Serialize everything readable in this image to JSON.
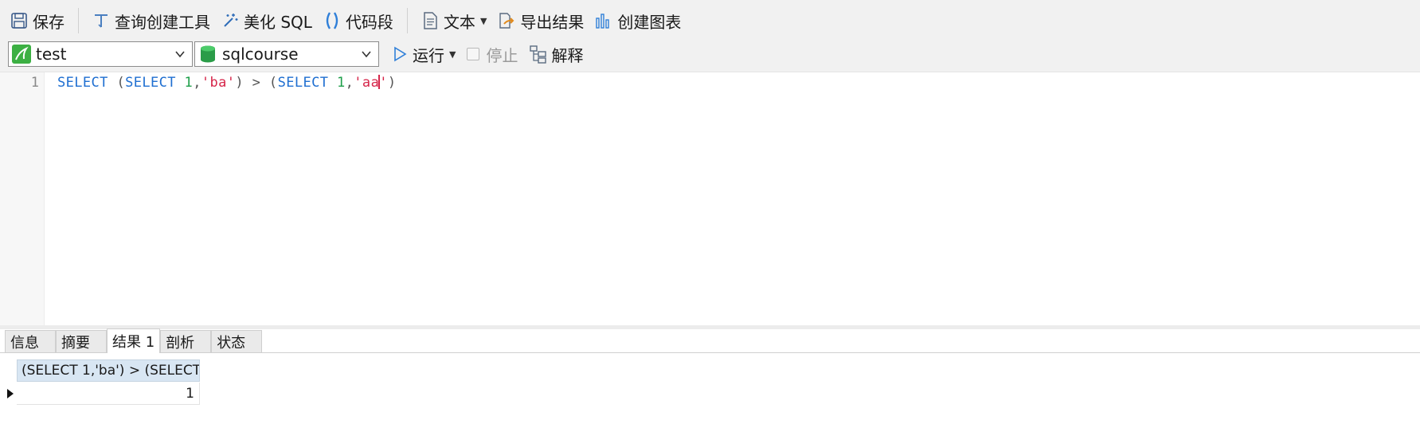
{
  "toolbar": {
    "save_label": "保存",
    "query_builder_label": "查询创建工具",
    "beautify_label": "美化 SQL",
    "snippet_label": "代码段",
    "text_label": "文本",
    "export_label": "导出结果",
    "chart_label": "创建图表"
  },
  "connection": {
    "value": "test"
  },
  "database": {
    "value": "sqlcourse"
  },
  "actions": {
    "run_label": "运行",
    "stop_label": "停止",
    "explain_label": "解释"
  },
  "editor": {
    "line_number": "1",
    "tokens": {
      "t1": "SELECT",
      "t2": " (",
      "t3": "SELECT",
      "t4": " ",
      "t5": "1",
      "t6": ",",
      "t7": "'ba'",
      "t8": ") > (",
      "t9": "SELECT",
      "t10": " ",
      "t11": "1",
      "t12": ",",
      "t13": "'aa",
      "t14": "'",
      "t15": ")"
    }
  },
  "result_tabs": [
    "信息",
    "摘要",
    "结果 1",
    "剖析",
    "状态"
  ],
  "results": {
    "column_header": "(SELECT 1,'ba') > (SELECT",
    "rows": [
      "1"
    ]
  },
  "colors": {
    "keyword": "#1f6fd1",
    "number": "#1e9f4a",
    "string": "#d6264a",
    "header_bg": "#d8e6f3"
  }
}
